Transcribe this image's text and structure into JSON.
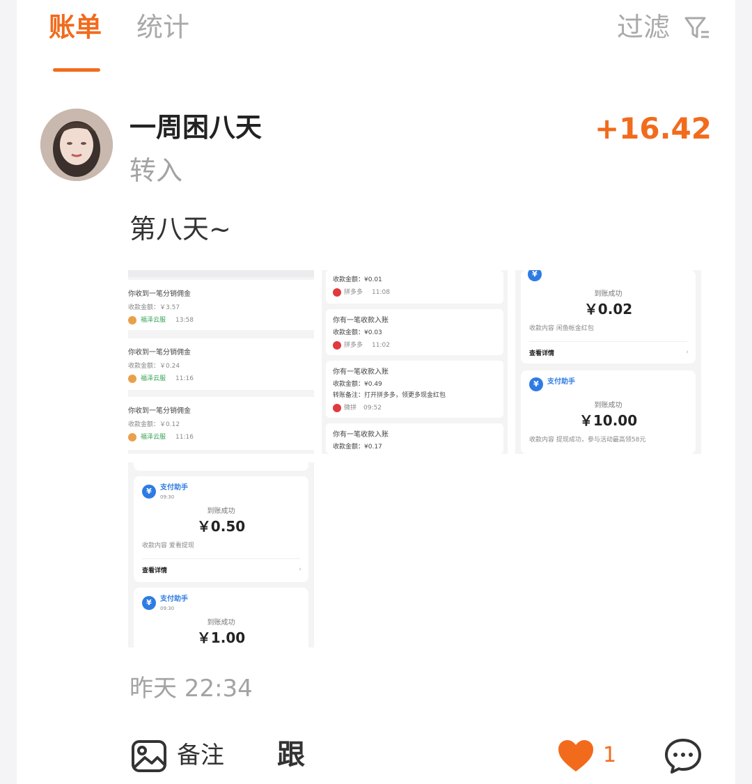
{
  "tabs": {
    "bill": "账单",
    "stats": "统计"
  },
  "filter": {
    "label": "过滤",
    "icon": "filter-icon"
  },
  "post": {
    "username": "一周困八天",
    "amount": "+16.42",
    "type": "转入",
    "note": "第八天~",
    "timestamp": "昨天 22:34"
  },
  "screenshot1": {
    "items": [
      {
        "title": "你收到一笔分销佣金",
        "amount": "收款金额：￥3.57",
        "source": "福泽云服",
        "time": "13:58"
      },
      {
        "title": "你收到一笔分销佣金",
        "amount": "收款金额：￥0.24",
        "source": "福泽云服",
        "time": "11:16"
      },
      {
        "title": "你收到一笔分销佣金",
        "amount": "收款金额：￥0.12",
        "source": "福泽云服",
        "time": "11:16"
      }
    ]
  },
  "screenshot2": {
    "items": [
      {
        "amount": "收款金额：¥0.01",
        "source": "拼多多",
        "time": "11:08"
      },
      {
        "title": "你有一笔收款入账",
        "amount": "收款金额：¥0.03",
        "source": "拼多多",
        "time": "11:02"
      },
      {
        "title": "你有一笔收款入账",
        "amount": "收款金额：¥0.49",
        "remark": "转账备注：打开拼多多，领更多现金红包",
        "source": "微拼",
        "time": "09:52"
      },
      {
        "title": "你有一笔收款入账",
        "amount": "收款金额：¥0.17"
      }
    ]
  },
  "screenshot3": {
    "pay1": {
      "status": "到账成功",
      "amount": "￥0.02",
      "content": "收款内容   闲鱼帐金红包",
      "details": "查看详情"
    },
    "pay2": {
      "assistant": "支付助手",
      "status": "到账成功",
      "amount": "￥10.00",
      "content": "收款内容   提现成功，参与活动最高领58元"
    }
  },
  "screenshot4": {
    "pay1": {
      "assistant": "支付助手",
      "time": "09:30",
      "status": "到账成功",
      "amount": "￥0.50",
      "content": "收款内容   爱看提现",
      "details": "查看详情"
    },
    "pay2": {
      "assistant": "支付助手",
      "time": "09:30",
      "status": "到账成功",
      "amount": "￥1.00"
    }
  },
  "actions": {
    "remark_label": "备注",
    "follow_label": "跟",
    "like_count": "1"
  },
  "colors": {
    "accent": "#f26b1d",
    "muted": "#a9a9a9",
    "pay_blue": "#2e7be4"
  }
}
